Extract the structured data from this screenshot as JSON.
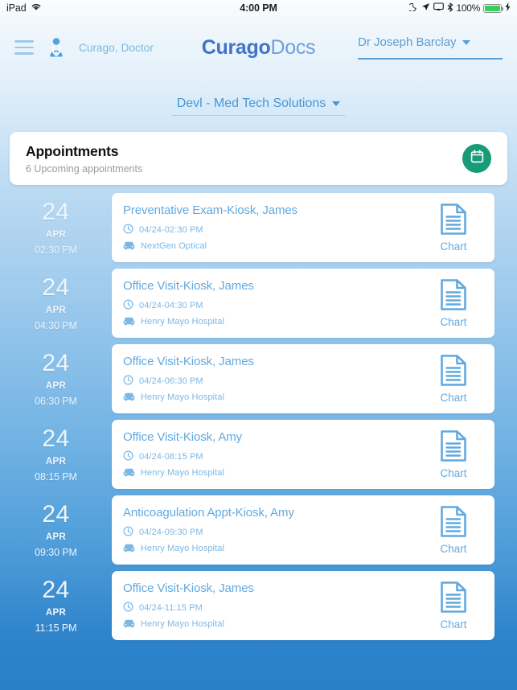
{
  "status_bar": {
    "device": "iPad",
    "wifi_icon": "wifi-icon",
    "time": "4:00 PM",
    "dnd_icon": "moon-icon",
    "location_icon": "location-arrow-icon",
    "airplay_icon": "screen-mirroring-icon",
    "bluetooth_icon": "bluetooth-icon",
    "battery_percent": "100%",
    "charging_icon": "lightning-bolt-icon",
    "battery_color": "#34d058"
  },
  "header": {
    "menu_icon": "hamburger-menu-icon",
    "doctor_icon": "doctor-avatar-icon",
    "doctor_label": "Curago, Doctor",
    "brand_bold": "Curago",
    "brand_light": "Docs",
    "user_name": "Dr Joseph Barclay",
    "user_caret_icon": "chevron-down-icon",
    "brand_color": "#3f74c8",
    "accent_color": "#5b9ed4"
  },
  "organization": {
    "selected": "Devl - Med Tech Solutions",
    "caret_icon": "chevron-down-icon"
  },
  "summary_card": {
    "title": "Appointments",
    "subtitle": "6 Upcoming appointments",
    "badge_icon": "calendar-icon",
    "badge_color": "#179b79"
  },
  "appointments": [
    {
      "day": "24",
      "month": "APR",
      "time": "02:30 PM",
      "title": "Preventative Exam-Kiosk, James",
      "clock_icon": "clock-icon",
      "datetime": "04/24-02:30 PM",
      "location_icon": "car-icon",
      "location": "NextGen Optical",
      "chart_icon": "document-icon",
      "chart_label": "Chart"
    },
    {
      "day": "24",
      "month": "APR",
      "time": "04:30 PM",
      "title": "Office Visit-Kiosk, James",
      "clock_icon": "clock-icon",
      "datetime": "04/24-04:30 PM",
      "location_icon": "car-icon",
      "location": "Henry Mayo Hospital",
      "chart_icon": "document-icon",
      "chart_label": "Chart"
    },
    {
      "day": "24",
      "month": "APR",
      "time": "06:30 PM",
      "title": "Office Visit-Kiosk, James",
      "clock_icon": "clock-icon",
      "datetime": "04/24-06:30 PM",
      "location_icon": "car-icon",
      "location": "Henry Mayo Hospital",
      "chart_icon": "document-icon",
      "chart_label": "Chart"
    },
    {
      "day": "24",
      "month": "APR",
      "time": "08:15 PM",
      "title": "Office Visit-Kiosk, Amy",
      "clock_icon": "clock-icon",
      "datetime": "04/24-08:15 PM",
      "location_icon": "car-icon",
      "location": "Henry Mayo Hospital",
      "chart_icon": "document-icon",
      "chart_label": "Chart"
    },
    {
      "day": "24",
      "month": "APR",
      "time": "09:30 PM",
      "title": "Anticoagulation Appt-Kiosk, Amy",
      "clock_icon": "clock-icon",
      "datetime": "04/24-09:30 PM",
      "location_icon": "car-icon",
      "location": "Henry Mayo Hospital",
      "chart_icon": "document-icon",
      "chart_label": "Chart"
    },
    {
      "day": "24",
      "month": "APR",
      "time": "11:15 PM",
      "title": "Office Visit-Kiosk, James",
      "clock_icon": "clock-icon",
      "datetime": "04/24-11:15 PM",
      "location_icon": "car-icon",
      "location": "Henry Mayo Hospital",
      "chart_icon": "document-icon",
      "chart_label": "Chart"
    }
  ]
}
